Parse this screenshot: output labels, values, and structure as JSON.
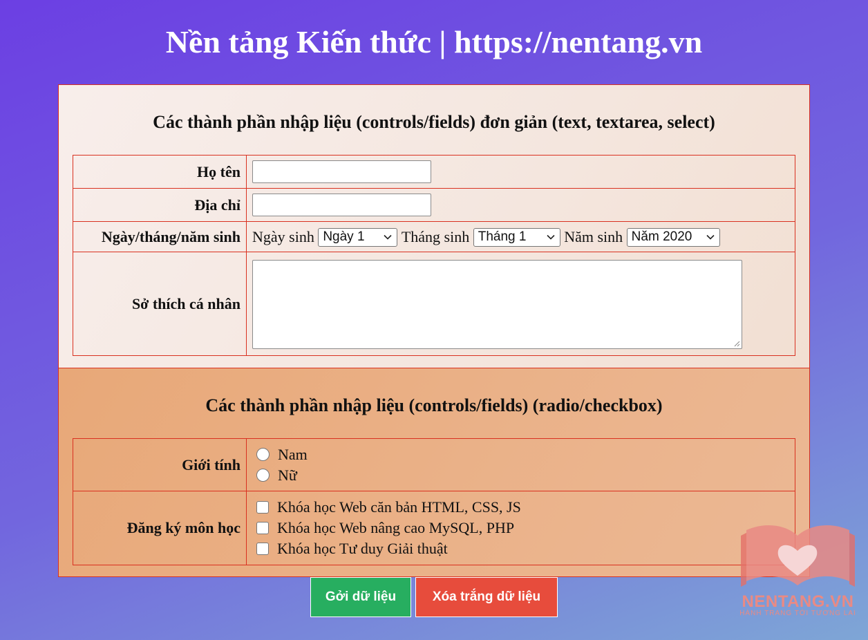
{
  "page": {
    "title": "Nền tảng Kiến thức | https://nentang.vn"
  },
  "section_simple": {
    "heading": "Các thành phần nhập liệu (controls/fields) đơn giản (text, textarea, select)",
    "fullname_label": "Họ tên",
    "fullname_value": "",
    "address_label": "Địa chỉ",
    "address_value": "",
    "dob_label": "Ngày/tháng/năm sinh",
    "day_label": "Ngày sinh",
    "day_selected": "Ngày 1",
    "month_label": "Tháng sinh",
    "month_selected": "Tháng 1",
    "year_label": "Năm sinh",
    "year_selected": "Năm 2020",
    "hobby_label": "Sở thích cá nhân",
    "hobby_value": ""
  },
  "section_choice": {
    "heading": "Các thành phần nhập liệu (controls/fields) (radio/checkbox)",
    "gender_label": "Giới tính",
    "gender_options": [
      "Nam",
      "Nữ"
    ],
    "courses_label": "Đăng ký môn học",
    "course_options": [
      "Khóa học Web căn bản HTML, CSS, JS",
      "Khóa học Web nâng cao MySQL, PHP",
      "Khóa học Tư duy Giải thuật"
    ]
  },
  "actions": {
    "submit_label": "Gởi dữ liệu",
    "reset_label": "Xóa trắng dữ liệu"
  },
  "watermark": {
    "brand": "NENTANG.VN",
    "slogan": "HÀNH TRANG TỚI TƯƠNG LAI"
  },
  "colors": {
    "background_start": "#6c3fe3",
    "background_end": "#7ea6d6",
    "border": "#d9301f",
    "submit": "#27ae60",
    "reset": "#e74c3c"
  }
}
